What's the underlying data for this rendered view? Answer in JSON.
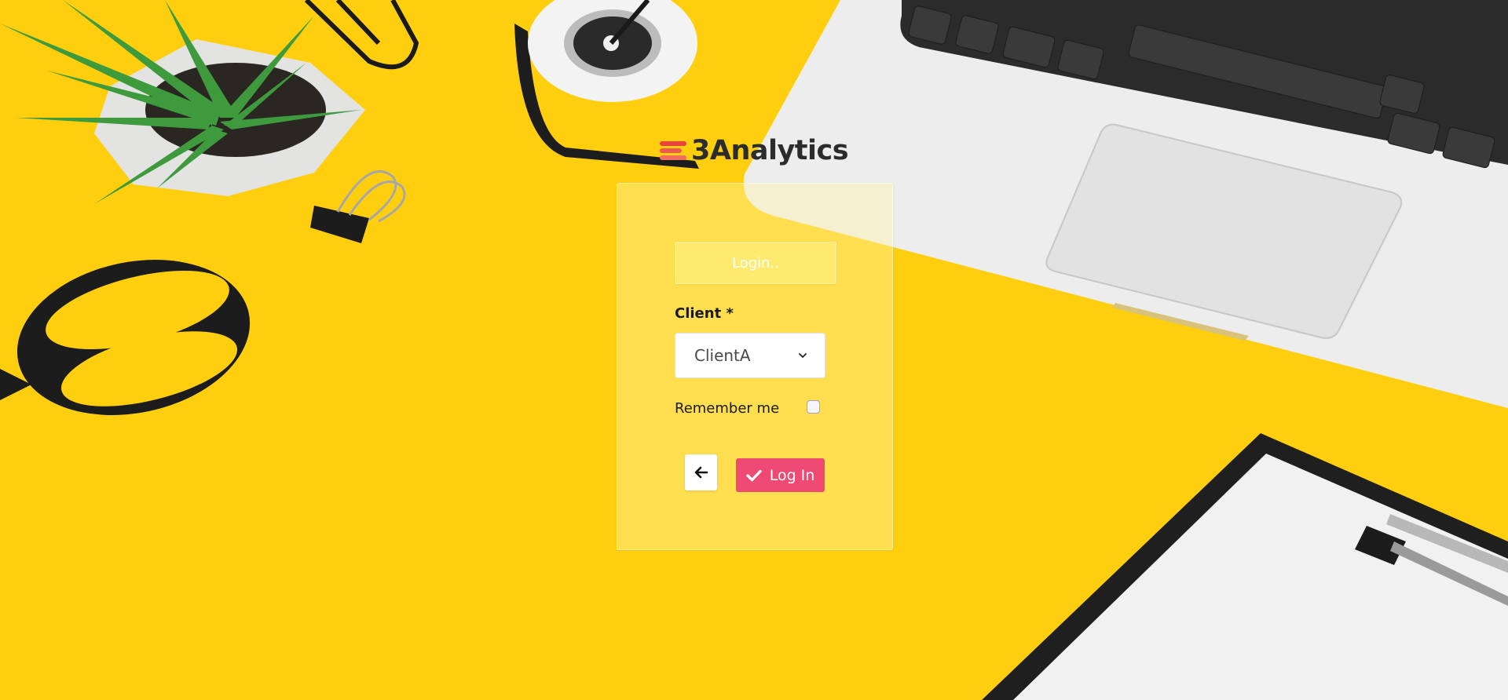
{
  "brand": {
    "name": "3Analytics",
    "logo_colors": [
      "#e8433f",
      "#ee5a4f",
      "#f36e5e"
    ]
  },
  "colors": {
    "background": "#ffcf0f",
    "primary_button": "#ef4a73"
  },
  "form": {
    "header": "Login..",
    "client_label": "Client *",
    "client_selected": "ClientA",
    "remember_label": "Remember me",
    "remember_checked": false,
    "back_icon": "arrow-left-icon",
    "login_icon": "check-icon",
    "login_label": "Log In"
  }
}
